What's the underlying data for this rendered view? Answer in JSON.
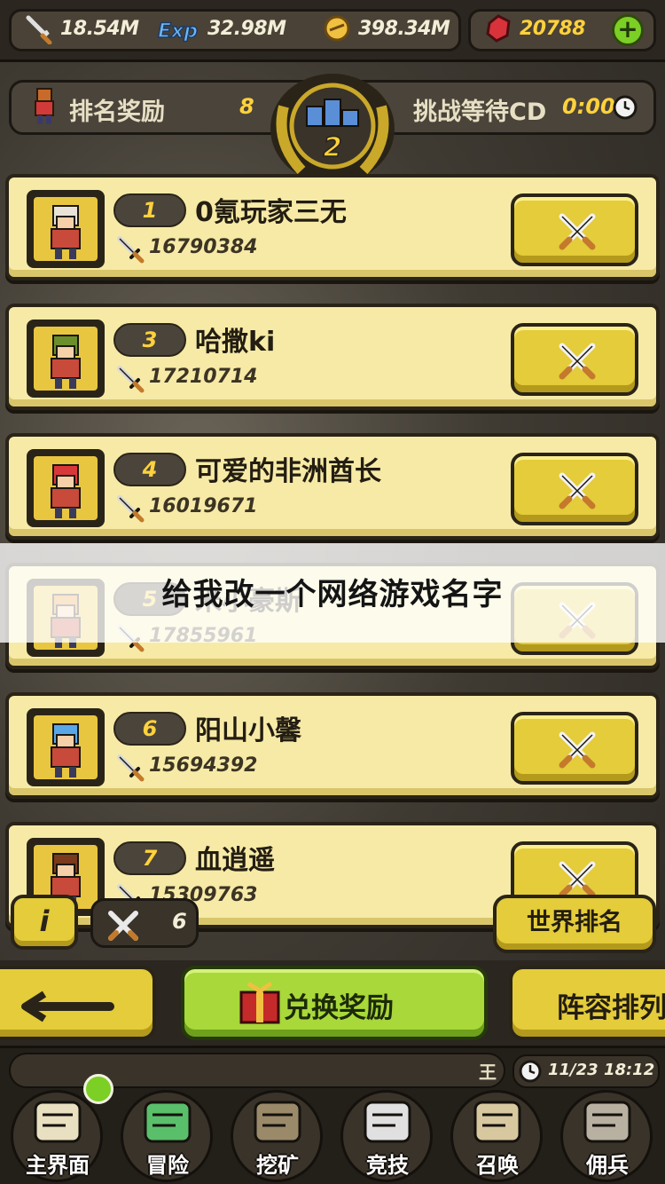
{
  "resources": {
    "attack": "18.54M",
    "exp": "32.98M",
    "coins": "398.34M",
    "gems": "20788"
  },
  "rank_header": {
    "reward_label": "排名奖励",
    "reward_value": "8",
    "cooldown_label": "挑战等待CD",
    "cooldown_value": "0:00",
    "my_rank": "2"
  },
  "players": [
    {
      "rank": "1",
      "name": "0氪玩家三无",
      "power": "16790384",
      "avatar_color": "#e9c640",
      "hair": "#e8e2d8"
    },
    {
      "rank": "3",
      "name": "哈撒ki",
      "power": "17210714",
      "avatar_color": "#e9c640",
      "hair": "#6b8f2a"
    },
    {
      "rank": "4",
      "name": "可爱的非洲酋长",
      "power": "16019671",
      "avatar_color": "#e9c640",
      "hair": "#d9383a"
    },
    {
      "rank": "5",
      "name": "米小豪斯",
      "power": "17855961",
      "avatar_color": "#e9c640",
      "hair": "#e8912a"
    },
    {
      "rank": "6",
      "name": "阳山小馨",
      "power": "15694392",
      "avatar_color": "#e9c640",
      "hair": "#5aa7e8"
    },
    {
      "rank": "7",
      "name": "血逍遥",
      "power": "15309763",
      "avatar_color": "#e9c640",
      "hair": "#7a3a1c"
    }
  ],
  "banner": {
    "text": "给我改一个网络游戏名字"
  },
  "controls": {
    "info_label": "i",
    "challenge_count": "6",
    "world_rank_label": "世界排名",
    "exchange_label": "兑换奖励",
    "lineup_label": "阵容排列"
  },
  "chat": {
    "name": "王",
    "time": "11/23 18:12"
  },
  "nav": [
    {
      "label": "主界面",
      "icon": "map-scroll-icon"
    },
    {
      "label": "冒险",
      "icon": "island-icon"
    },
    {
      "label": "挖矿",
      "icon": "pickaxe-icon"
    },
    {
      "label": "竞技",
      "icon": "crossed-swords-icon"
    },
    {
      "label": "召唤",
      "icon": "summon-scroll-icon"
    },
    {
      "label": "佣兵",
      "icon": "tent-icon"
    }
  ],
  "colors": {
    "gold": "#ffd23c",
    "button_yellow": "#e4cc3a",
    "button_green": "#a8d83a",
    "row_bg": "#f6eaa6"
  }
}
